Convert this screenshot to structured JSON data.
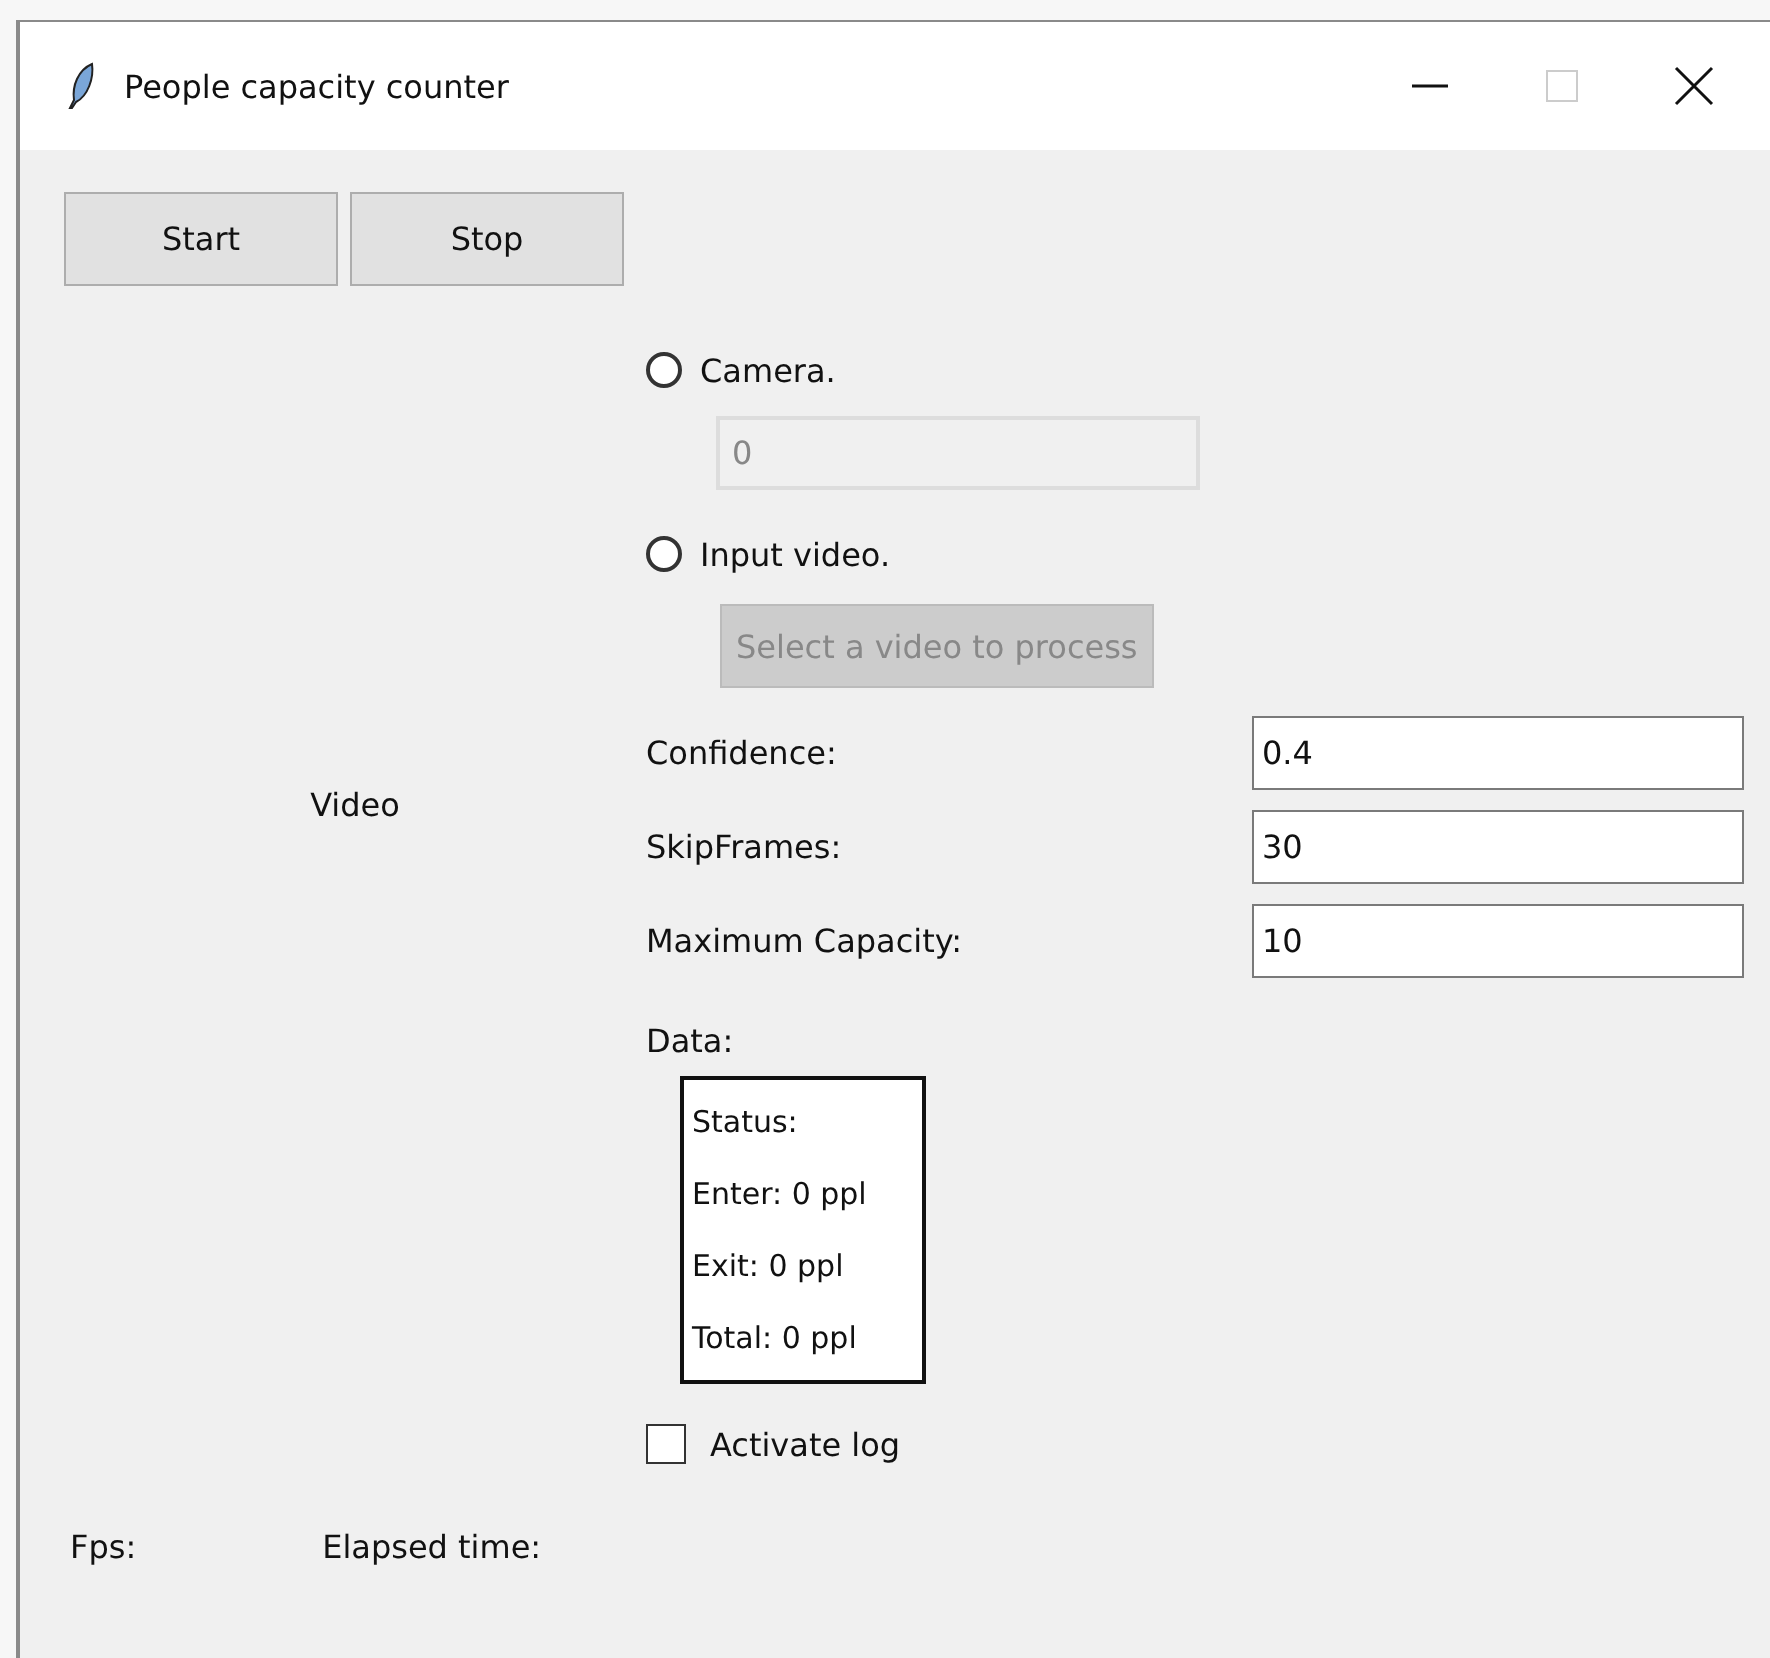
{
  "window": {
    "title": "People capacity counter"
  },
  "toolbar": [
    {
      "label": "Start"
    },
    {
      "label": "Stop"
    }
  ],
  "video_label": "Video",
  "sources": [
    {
      "kind": "entry",
      "label": "Camera.",
      "selected": false,
      "value": "0",
      "disabled": true
    },
    {
      "kind": "button",
      "label": "Input video.",
      "selected": false,
      "value": "Select a video to process",
      "disabled": true
    }
  ],
  "params": [
    {
      "label": "Confidence:",
      "value": "0.4"
    },
    {
      "label": "SkipFrames:",
      "value": "30"
    },
    {
      "label": "Maximum Capacity:",
      "value": "10"
    }
  ],
  "data": {
    "label": "Data:",
    "lines": [
      "Status:",
      "Enter: 0 ppl",
      "Exit: 0 ppl",
      "Total: 0 ppl"
    ]
  },
  "log": {
    "label": "Activate log",
    "checked": false
  },
  "status_bar": [
    "Fps:",
    "Elapsed time:"
  ]
}
